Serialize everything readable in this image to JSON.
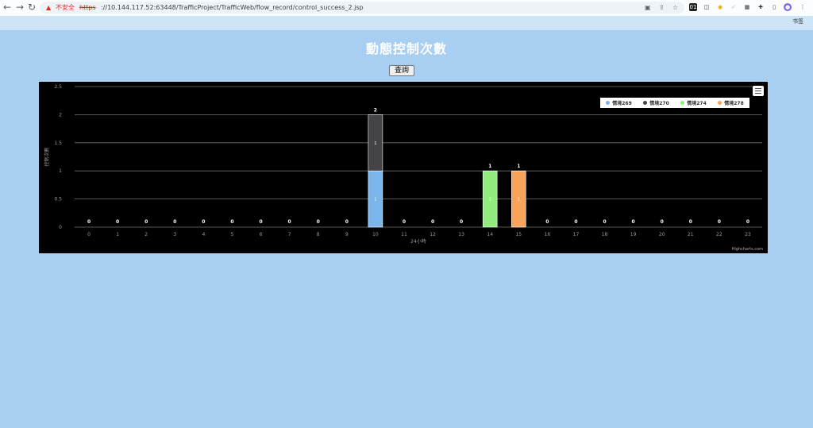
{
  "browser": {
    "insecure_label": "不安全",
    "url_scheme": "https",
    "url_rest": "://10.144.117.52:63448/TrafficProject/TrafficWeb/flow_record/control_success_2.jsp",
    "bookmark_label": "书签"
  },
  "page": {
    "title": "動態控制次數",
    "query_button": "查詢"
  },
  "chart_data": {
    "type": "bar",
    "stacked": true,
    "title": "",
    "xlabel": "24小時",
    "ylabel": "控制次數",
    "ylim": [
      0,
      2.5
    ],
    "yticks": [
      "0",
      "0.5",
      "1",
      "1.5",
      "2",
      "2.5"
    ],
    "categories": [
      "0",
      "1",
      "2",
      "3",
      "4",
      "5",
      "6",
      "7",
      "8",
      "9",
      "10",
      "11",
      "12",
      "13",
      "14",
      "15",
      "16",
      "17",
      "18",
      "19",
      "20",
      "21",
      "22",
      "23"
    ],
    "series": [
      {
        "name": "情境269",
        "color": "#7cb5ec",
        "values": [
          0,
          0,
          0,
          0,
          0,
          0,
          0,
          0,
          0,
          0,
          1,
          0,
          0,
          0,
          0,
          0,
          0,
          0,
          0,
          0,
          0,
          0,
          0,
          0
        ]
      },
      {
        "name": "情境270",
        "color": "#434348",
        "values": [
          0,
          0,
          0,
          0,
          0,
          0,
          0,
          0,
          0,
          0,
          1,
          0,
          0,
          0,
          0,
          0,
          0,
          0,
          0,
          0,
          0,
          0,
          0,
          0
        ]
      },
      {
        "name": "情境274",
        "color": "#90ed7d",
        "values": [
          0,
          0,
          0,
          0,
          0,
          0,
          0,
          0,
          0,
          0,
          0,
          0,
          0,
          0,
          1,
          0,
          0,
          0,
          0,
          0,
          0,
          0,
          0,
          0
        ]
      },
      {
        "name": "情境278",
        "color": "#f7a35c",
        "values": [
          0,
          0,
          0,
          0,
          0,
          0,
          0,
          0,
          0,
          0,
          0,
          0,
          0,
          0,
          0,
          1,
          0,
          0,
          0,
          0,
          0,
          0,
          0,
          0
        ]
      }
    ],
    "totals": [
      0,
      0,
      0,
      0,
      0,
      0,
      0,
      0,
      0,
      0,
      2,
      0,
      0,
      0,
      1,
      1,
      0,
      0,
      0,
      0,
      0,
      0,
      0,
      0
    ],
    "grid": true,
    "legend_position": "top-right",
    "credits": "Highcharts.com"
  }
}
